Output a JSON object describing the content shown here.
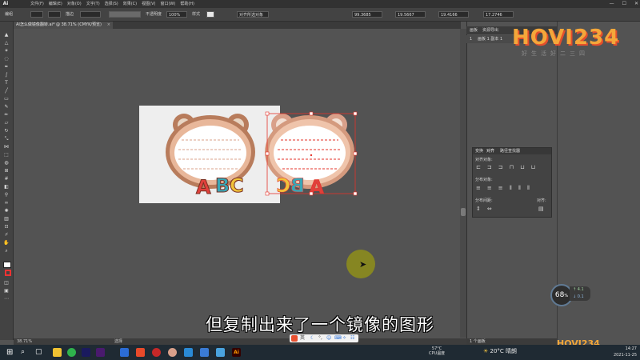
{
  "menubar": {
    "logo": "Ai",
    "menus": [
      "文件(F)",
      "编辑(E)",
      "对象(O)",
      "文字(T)",
      "选择(S)",
      "效果(C)",
      "视图(V)",
      "窗口(W)",
      "帮助(H)"
    ],
    "window_controls": [
      "—",
      "☐",
      "✕"
    ]
  },
  "controlbar": {
    "group_label": "编组",
    "stroke_label": "描边",
    "opacity_label": "不透明度",
    "opacity_value": "100%",
    "style_label": "样式",
    "align_label": "对齐所选对象",
    "x_value": "99.3685",
    "y_value": "19.5667",
    "w_value": "19.4166",
    "h_value": "17.2746"
  },
  "document_tab": {
    "title": "AI怎么做镜像翻转.ai* @ 38.71% (CMYK/预览)",
    "close": "×"
  },
  "status": {
    "zoom": "38.71%",
    "tool": "选择"
  },
  "layers_panel": {
    "tabs": [
      "画板",
      "资源导出"
    ],
    "row_index": "1",
    "row_label": "画板 1 副本 1"
  },
  "align_panel": {
    "tabs": [
      "变换",
      "对齐",
      "路径查找器"
    ],
    "align_objects_label": "对齐对象:",
    "distribute_objects_label": "分布对象:",
    "distribute_spacing_label": "分布间距:",
    "align_to_label": "对齐:"
  },
  "artboard_label": "1 个画板",
  "subtitle": "但复制出来了一个镜像的图形",
  "ime": {
    "label": "英"
  },
  "gauge": {
    "value": "68",
    "unit": "%",
    "upload": "4.1",
    "download": "0.1"
  },
  "taskbar": {
    "cpu_temp": "57°C",
    "cpu_label": "CPU温度",
    "weather_temp": "20°C",
    "weather_text": "晴朗",
    "time": "14:27",
    "date": "2021-11-25"
  },
  "watermark": {
    "brand": "HOVI234",
    "slogan": "好生活好二三四"
  },
  "artwork": {
    "letters_left": [
      "A",
      "B",
      "C"
    ],
    "letters_right": [
      "C",
      "B",
      "A"
    ],
    "colors": {
      "frame": "#b87c5c",
      "frame_light": "#e8b79a",
      "letter_a": "#e0403b",
      "letter_b": "#3aa6b5",
      "letter_c": "#f0c23b",
      "selection": "#e5332a"
    }
  }
}
